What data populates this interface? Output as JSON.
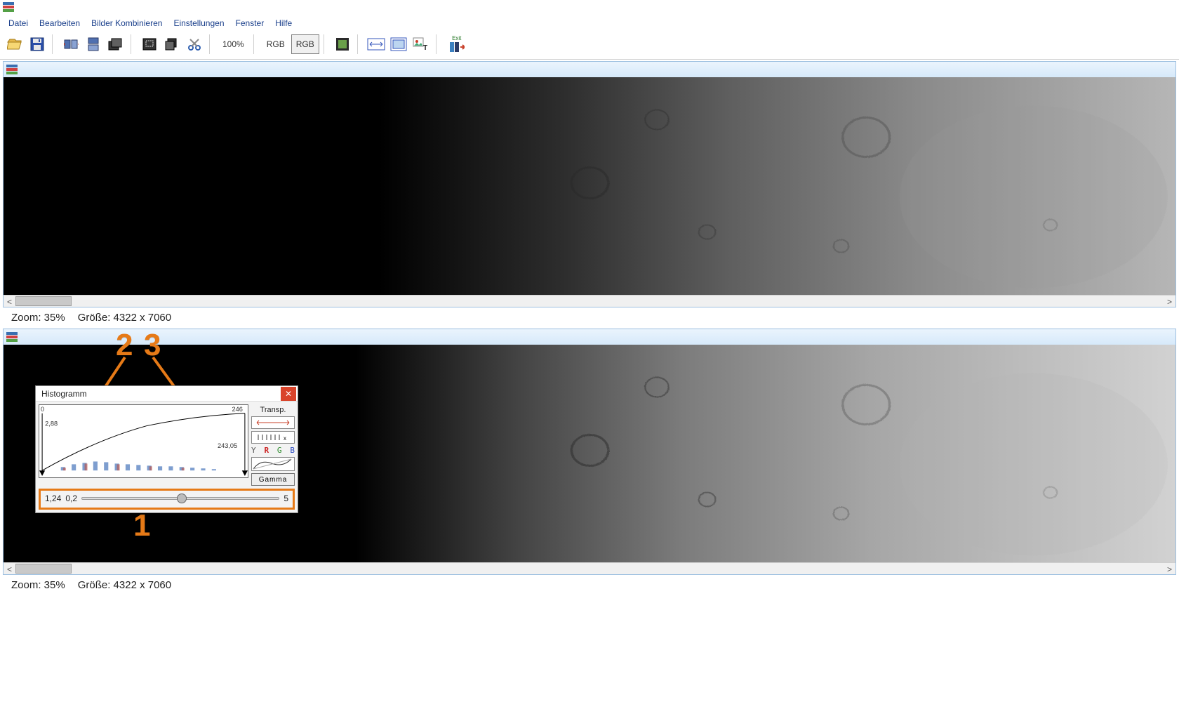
{
  "app_title": "",
  "menu": {
    "file": "Datei",
    "edit": "Bearbeiten",
    "combine": "Bilder Kombinieren",
    "settings": "Einstellungen",
    "window": "Fenster",
    "help": "Hilfe"
  },
  "toolbar": {
    "zoom_label": "100%",
    "rgb1": "RGB",
    "rgb2": "RGB",
    "exit_label": "Exit",
    "icons": {
      "open": "folder-open-icon",
      "save": "floppy-icon",
      "mirror_h": "mirror-horizontal-icon",
      "mirror_v": "mirror-vertical-icon",
      "stack": "stack-icon",
      "crop": "crop-icon",
      "copy": "copy-icon",
      "cut": "cut-icon",
      "layers": "layers-icon",
      "fit": "fit-icon",
      "fith": "fit-horizontal-icon",
      "text": "text-tool-icon",
      "exit": "exit-icon"
    }
  },
  "panel": {
    "zoom_label": "Zoom: 35%",
    "size_label": "Größe: 4322 x 7060"
  },
  "histogram": {
    "title": "Histogramm",
    "axis_min": "0",
    "axis_max": "246",
    "low_marker": "2,88",
    "high_marker": "243,05",
    "gamma_value": "1,24",
    "slider_min": "0,2",
    "slider_max": "5",
    "transp_label": "Transp.",
    "channels": [
      "Y",
      "R",
      "G",
      "B"
    ],
    "gamma_btn": "Gamma"
  },
  "annotations": {
    "one": "1",
    "two": "2",
    "three": "3"
  },
  "chart_data": {
    "type": "line",
    "title": "Histogramm",
    "xrange": [
      0,
      246
    ],
    "low_clip": 2.88,
    "high_clip": 243.05,
    "gamma": 1.24,
    "gamma_slider": {
      "min": 0.2,
      "max": 5,
      "value": 1.24
    },
    "histogram_buckets_approx": [
      0.0,
      0.0,
      0.0,
      0.01,
      0.02,
      0.02,
      0.03,
      0.03,
      0.03,
      0.03,
      0.03,
      0.02,
      0.02,
      0.02,
      0.02,
      0.02,
      0.02,
      0.02,
      0.02,
      0.01,
      0.01,
      0.01,
      0.01,
      0.01,
      0.0
    ],
    "histogram_bucket_x": [
      0,
      10,
      20,
      30,
      40,
      50,
      60,
      70,
      80,
      90,
      100,
      110,
      120,
      130,
      140,
      150,
      160,
      170,
      180,
      190,
      200,
      210,
      220,
      230,
      240
    ],
    "gamma_curve_points": {
      "x": [
        0,
        31,
        62,
        92,
        123,
        154,
        185,
        215,
        246
      ],
      "y": [
        0,
        68,
        107,
        137,
        163,
        186,
        208,
        228,
        246
      ]
    }
  }
}
